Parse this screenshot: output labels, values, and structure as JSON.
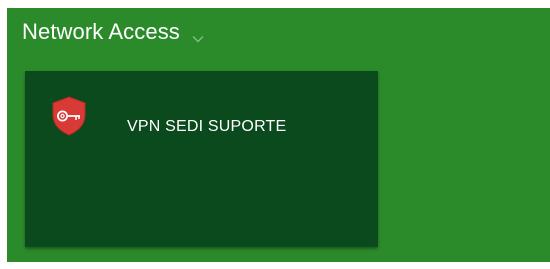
{
  "section": {
    "title": "Network Access"
  },
  "tiles": [
    {
      "label": "VPN SEDI SUPORTE",
      "icon": "shield-key-icon"
    }
  ],
  "colors": {
    "background": "#2b8b2b",
    "tile": "#0b4a1d",
    "icon_red": "#d93a35"
  }
}
